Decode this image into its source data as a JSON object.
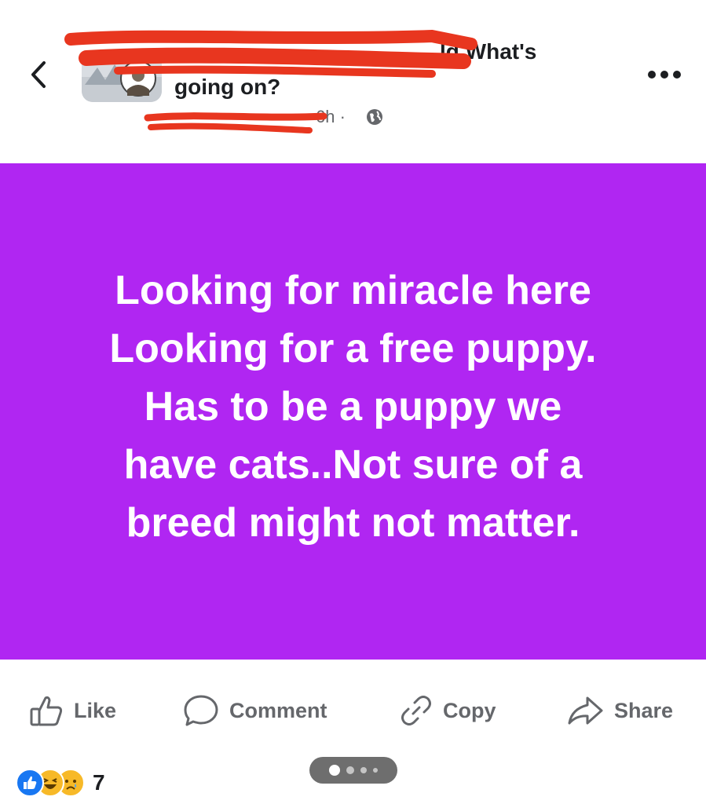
{
  "header": {
    "title_line1": "ld What's",
    "title_line2": "going on?",
    "time": "6h ·",
    "privacy_icon": "globe-icon",
    "back_icon": "chevron-left-icon",
    "more_icon": "more-horizontal-icon"
  },
  "post": {
    "lines": [
      "Looking for miracle here",
      "Looking for a free puppy.",
      "Has to be a puppy we",
      "have cats..Not sure of a",
      "breed might not matter."
    ],
    "background_color": "#b026f2",
    "text_color": "#ffffff"
  },
  "actions": {
    "like": "Like",
    "comment": "Comment",
    "copy": "Copy",
    "share": "Share"
  },
  "reactions": {
    "count": "7",
    "types": [
      "like",
      "haha",
      "sad"
    ]
  },
  "colors": {
    "redaction": "#e8361f",
    "muted": "#65676b",
    "like_blue": "#1877f2"
  }
}
